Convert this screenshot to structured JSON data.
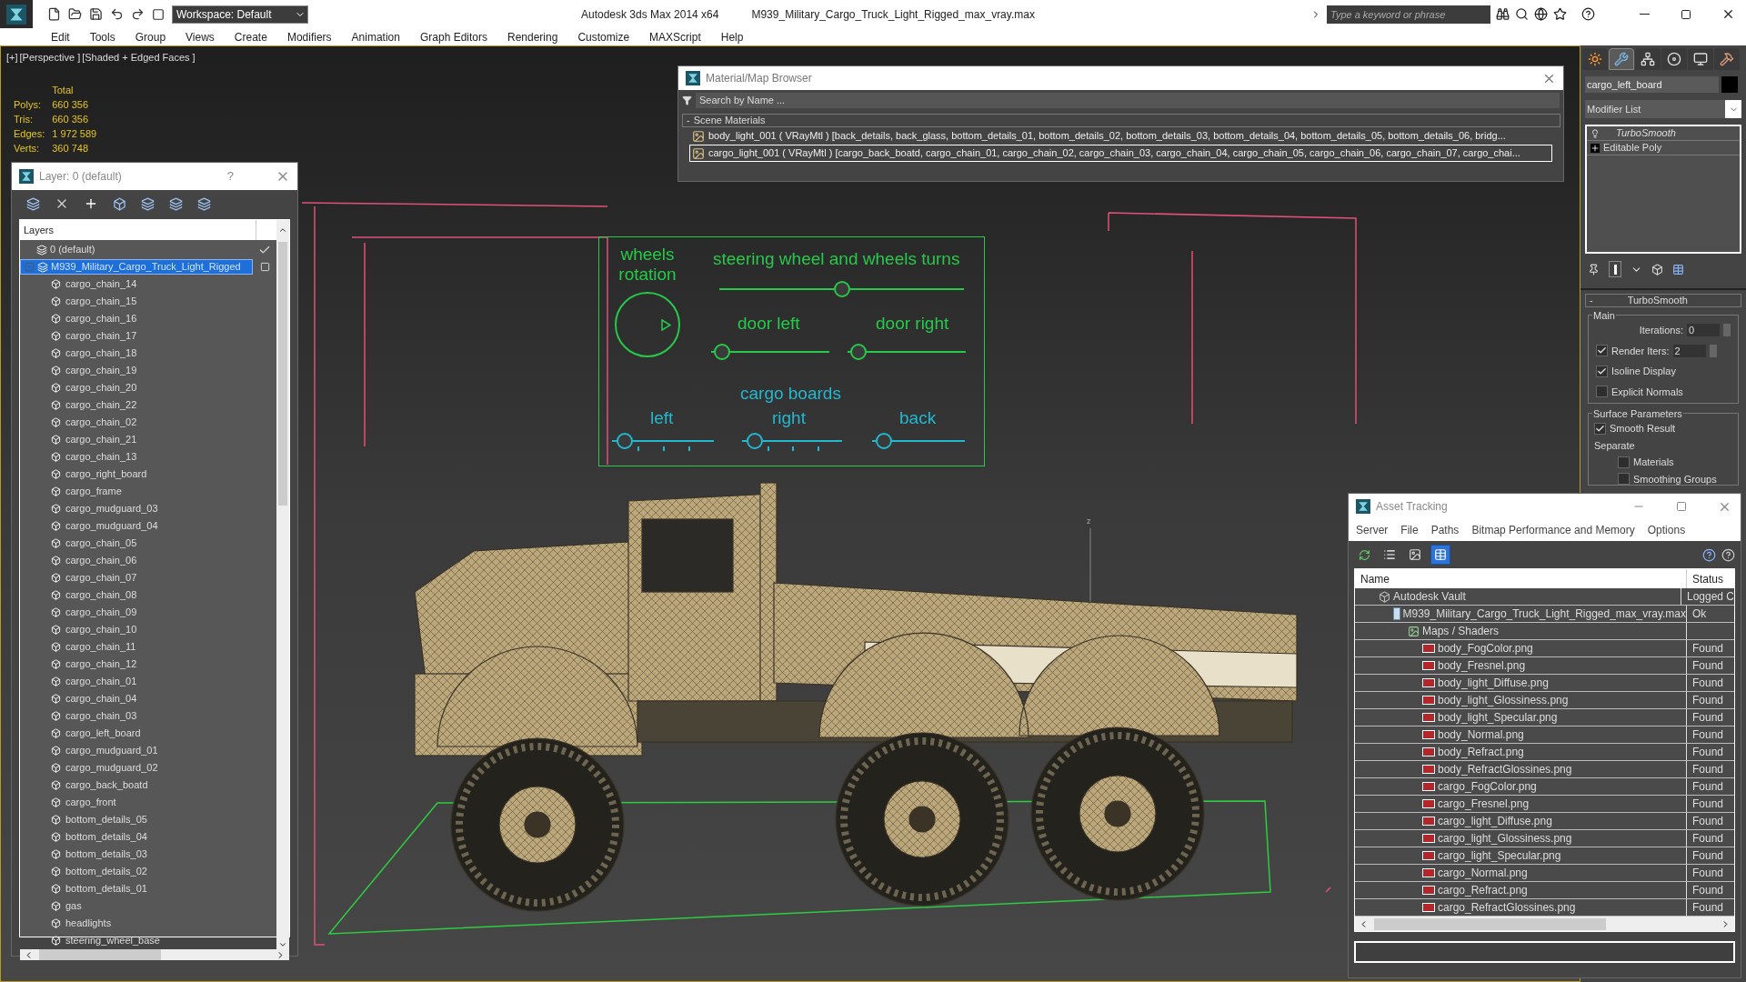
{
  "title_bar": {
    "workspace": "Workspace: Default",
    "app_title": "Autodesk 3ds Max  2014 x64",
    "file_name": "M939_Military_Cargo_Truck_Light_Rigged_max_vray.max",
    "search": {
      "placeholder": "Type a keyword or phrase"
    }
  },
  "menu_bar": [
    "Edit",
    "Tools",
    "Group",
    "Views",
    "Create",
    "Modifiers",
    "Animation",
    "Graph Editors",
    "Rendering",
    "Customize",
    "MAXScript",
    "Help"
  ],
  "viewport": {
    "labels": [
      "[+]",
      "[Perspective ]",
      "[Shaded + Edged Faces ]"
    ],
    "stats": {
      "header": "Total",
      "rows": [
        {
          "label": "Polys:",
          "value": "660 356"
        },
        {
          "label": "Tris:",
          "value": "660 356"
        },
        {
          "label": "Edges:",
          "value": "1 972 589"
        },
        {
          "label": "Verts:",
          "value": "360 748"
        }
      ]
    },
    "axis_label": "z"
  },
  "layer_dialog": {
    "title": "Layer: 0 (default)",
    "help": "?",
    "column": "Layers",
    "layers": [
      {
        "name": "0 (default)",
        "selected": false,
        "active": true
      },
      {
        "name": "M939_Military_Cargo_Truck_Light_Rigged",
        "selected": true,
        "active": false,
        "expanded": true,
        "children": [
          {
            "name": "cargo_chain_14"
          },
          {
            "name": "cargo_chain_15"
          },
          {
            "name": "cargo_chain_16"
          },
          {
            "name": "cargo_chain_17"
          },
          {
            "name": "cargo_chain_18"
          },
          {
            "name": "cargo_chain_19"
          },
          {
            "name": "cargo_chain_20"
          },
          {
            "name": "cargo_chain_22"
          },
          {
            "name": "cargo_chain_02"
          },
          {
            "name": "cargo_chain_21"
          },
          {
            "name": "cargo_chain_13"
          },
          {
            "name": "cargo_right_board"
          },
          {
            "name": "cargo_frame"
          },
          {
            "name": "cargo_mudguard_03"
          },
          {
            "name": "cargo_mudguard_04"
          },
          {
            "name": "cargo_chain_05"
          },
          {
            "name": "cargo_chain_06"
          },
          {
            "name": "cargo_chain_07"
          },
          {
            "name": "cargo_chain_08"
          },
          {
            "name": "cargo_chain_09"
          },
          {
            "name": "cargo_chain_10"
          },
          {
            "name": "cargo_chain_11"
          },
          {
            "name": "cargo_chain_12"
          },
          {
            "name": "cargo_chain_01"
          },
          {
            "name": "cargo_chain_04"
          },
          {
            "name": "cargo_chain_03"
          },
          {
            "name": "cargo_left_board"
          },
          {
            "name": "cargo_mudguard_01"
          },
          {
            "name": "cargo_mudguard_02"
          },
          {
            "name": "cargo_back_boatd"
          },
          {
            "name": "cargo_front"
          },
          {
            "name": "bottom_details_05"
          },
          {
            "name": "bottom_details_04"
          },
          {
            "name": "bottom_details_03"
          },
          {
            "name": "bottom_details_02"
          },
          {
            "name": "bottom_details_01"
          },
          {
            "name": "gas"
          },
          {
            "name": "headlights"
          },
          {
            "name": "steering_wheel_base"
          }
        ]
      }
    ]
  },
  "material_browser": {
    "title": "Material/Map Browser",
    "search": {
      "placeholder": "Search by Name ..."
    },
    "section": {
      "toggle": "-",
      "label": "Scene Materials"
    },
    "materials": [
      {
        "text": "body_light_001 ( VRayMtl ) [back_details, back_glass, bottom_details_01, bottom_details_02, bottom_details_03, bottom_details_04, bottom_details_05, bottom_details_06, bridg...",
        "selected": false
      },
      {
        "text": "cargo_light_001  ( VRayMtl )  [cargo_back_boatd, cargo_chain_01, cargo_chain_02, cargo_chain_03, cargo_chain_04, cargo_chain_05, cargo_chain_06, cargo_chain_07, cargo_chai...",
        "selected": true
      }
    ]
  },
  "rig_controls": {
    "wheels_rotation": {
      "label": "wheels rotation"
    },
    "steering": {
      "label": "steering wheel and wheels turns",
      "level": 0.5
    },
    "doors": [
      {
        "label": "door left",
        "level": 0.03
      },
      {
        "label": "door right",
        "level": 0.03
      }
    ],
    "cargo_boards": {
      "label": "cargo boards",
      "sliders": [
        {
          "label": "left",
          "level": 0.05
        },
        {
          "label": "right",
          "level": 0.05
        },
        {
          "label": "back",
          "level": 0.05
        }
      ]
    }
  },
  "command_panel": {
    "tabs": [
      {
        "kind": "create",
        "selected": false
      },
      {
        "kind": "modify",
        "selected": true
      },
      {
        "kind": "hierarchy",
        "selected": false
      },
      {
        "kind": "motion",
        "selected": false
      },
      {
        "kind": "display",
        "selected": false
      },
      {
        "kind": "utilities",
        "selected": false
      }
    ],
    "object_name": "cargo_left_board",
    "modifier_list": "Modifier List",
    "stack": [
      {
        "name": "TurboSmooth",
        "kind": "modifier"
      },
      {
        "name": "Editable Poly",
        "kind": "base"
      }
    ],
    "rollout": {
      "toggle": "-",
      "title": "TurboSmooth",
      "main": {
        "label": "Main",
        "iterations": {
          "label": "Iterations:",
          "value": "0"
        },
        "render_iters": {
          "label": "Render Iters:",
          "value": "2",
          "checked": true
        },
        "checks": [
          {
            "label": "Isoline Display",
            "checked": true
          },
          {
            "label": "Explicit Normals",
            "checked": false
          }
        ]
      },
      "surface": {
        "label": "Surface Parameters",
        "smooth_result": {
          "label": "Smooth Result",
          "checked": true
        },
        "separate": "Separate",
        "checks": [
          {
            "label": "Materials",
            "checked": false
          },
          {
            "label": "Smoothing Groups",
            "checked": false
          }
        ]
      }
    }
  },
  "asset_tracking": {
    "title": "Asset Tracking",
    "menu": [
      "Server",
      "File",
      "Paths",
      "Bitmap Performance and Memory",
      "Options"
    ],
    "toolbar": [
      {
        "kind": "refresh",
        "selected": false
      },
      {
        "kind": "list",
        "selected": false
      },
      {
        "kind": "thumbnails",
        "selected": false
      },
      {
        "kind": "table",
        "selected": true
      }
    ],
    "columns": [
      "Name",
      "Status"
    ],
    "tree": [
      {
        "name": "Autodesk Vault",
        "status": "Logged C",
        "kind": "vault",
        "children": [
          {
            "name": "M939_Military_Cargo_Truck_Light_Rigged_max_vray.max",
            "status": "Ok",
            "kind": "scene",
            "children": [
              {
                "name": "Maps / Shaders",
                "kind": "folder",
                "children": [
                  {
                    "name": "body_FogColor.png",
                    "status": "Found",
                    "kind": "png"
                  },
                  {
                    "name": "body_Fresnel.png",
                    "status": "Found",
                    "kind": "png"
                  },
                  {
                    "name": "body_light_Diffuse.png",
                    "status": "Found",
                    "kind": "png"
                  },
                  {
                    "name": "body_light_Glossiness.png",
                    "status": "Found",
                    "kind": "png"
                  },
                  {
                    "name": "body_light_Specular.png",
                    "status": "Found",
                    "kind": "png"
                  },
                  {
                    "name": "body_Normal.png",
                    "status": "Found",
                    "kind": "png"
                  },
                  {
                    "name": "body_Refract.png",
                    "status": "Found",
                    "kind": "png"
                  },
                  {
                    "name": "body_RefractGlossines.png",
                    "status": "Found",
                    "kind": "png"
                  },
                  {
                    "name": "cargo_FogColor.png",
                    "status": "Found",
                    "kind": "png"
                  },
                  {
                    "name": "cargo_Fresnel.png",
                    "status": "Found",
                    "kind": "png"
                  },
                  {
                    "name": "cargo_light_Diffuse.png",
                    "status": "Found",
                    "kind": "png"
                  },
                  {
                    "name": "cargo_light_Glossiness.png",
                    "status": "Found",
                    "kind": "png"
                  },
                  {
                    "name": "cargo_light_Specular.png",
                    "status": "Found",
                    "kind": "png"
                  },
                  {
                    "name": "cargo_Normal.png",
                    "status": "Found",
                    "kind": "png"
                  },
                  {
                    "name": "cargo_Refract.png",
                    "status": "Found",
                    "kind": "png"
                  },
                  {
                    "name": "cargo_RefractGlossines.png",
                    "status": "Found",
                    "kind": "png"
                  }
                ]
              }
            ]
          }
        ]
      }
    ]
  }
}
